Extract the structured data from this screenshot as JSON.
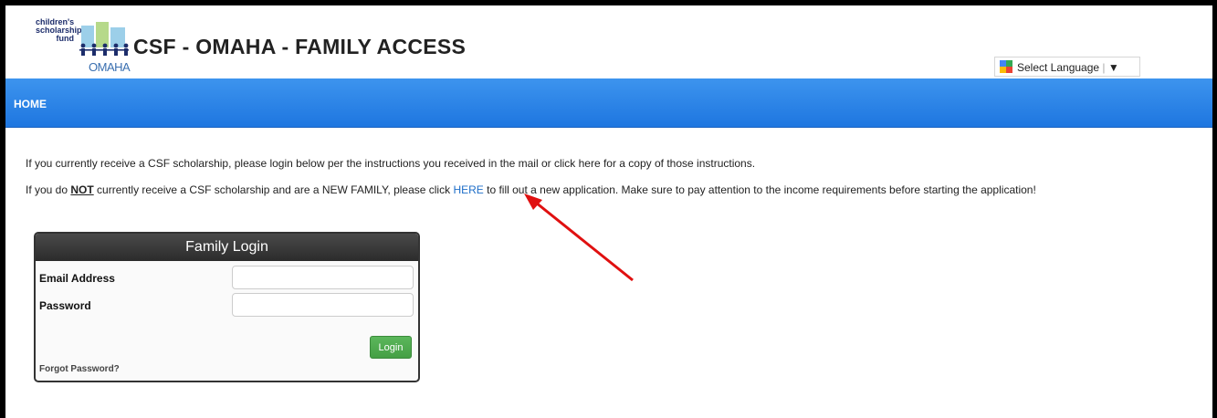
{
  "header": {
    "logo": {
      "line1": "children's",
      "line2": "scholarship",
      "line3": "fund",
      "city": "OMAHA"
    },
    "title": "CSF - OMAHA - FAMILY ACCESS",
    "language_select": "Select Language",
    "language_arrow": "▼"
  },
  "nav": {
    "home": "HOME"
  },
  "content": {
    "p1": "If you currently receive a CSF scholarship, please login below per the instructions you received in the mail or click here for a copy of those instructions.",
    "p2_a": "If you do ",
    "p2_bold": "NOT",
    "p2_b": " currently receive a CSF scholarship and are a NEW FAMILY, please click ",
    "p2_link": "HERE",
    "p2_c": " to fill out a new application. Make sure to pay attention to the income requirements before starting the application!"
  },
  "login": {
    "title": "Family Login",
    "email_label": "Email Address",
    "email_value": "",
    "password_label": "Password",
    "password_value": "",
    "button": "Login",
    "forgot": "Forgot Password?"
  },
  "colors": {
    "nav_blue": "#2a84e8",
    "link_blue": "#1e6ec8",
    "login_green": "#51ac51",
    "arrow_red": "#e01010"
  }
}
